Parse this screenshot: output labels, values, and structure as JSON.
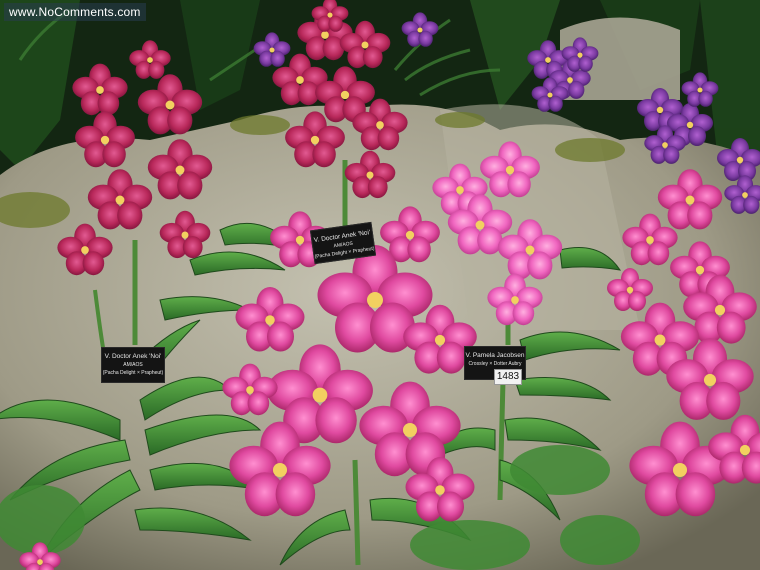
{
  "watermark": "www.NoComments.com",
  "labels": {
    "left": {
      "line1": "V. Doctor Anek 'Noi'",
      "line2": "AM/AOS",
      "line3": "(Pacha Delight × Prapheut)"
    },
    "center": {
      "line1": "V. Doctor Anek 'Noi'",
      "line2": "AM/AOS",
      "line3": "(Pacha Delight × Prapheut)"
    },
    "right": {
      "line1": "V. Pamela Jacobsen",
      "line2": "Crossley × Dotter Aubry"
    }
  },
  "tag_number": "1483"
}
